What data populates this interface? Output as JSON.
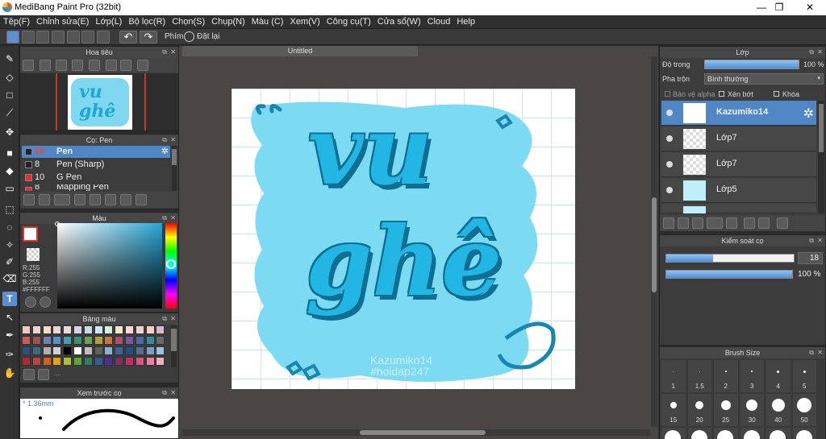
{
  "window": {
    "title": "MediBang Paint Pro (32bit)",
    "min": "—",
    "max": "❐",
    "close": "✕"
  },
  "menu": [
    "Tệp(F)",
    "Chỉnh sửa(E)",
    "Lớp(L)",
    "Bộ lọc(R)",
    "Chọn(S)",
    "Chụp(N)",
    "Màu (C)",
    "Xem(V)",
    "Công cụ(T)",
    "Cửa sổ(W)",
    "Cloud",
    "Help"
  ],
  "toolbar": {
    "shortcut_label": "Phím",
    "reset_label": "Đặt lại"
  },
  "navigator": {
    "title": "Hoa tiêu"
  },
  "brush_panel": {
    "title": "Cọ: Pen",
    "items": [
      {
        "size": "18",
        "name": "Pen",
        "color": "#222222"
      },
      {
        "size": "8",
        "name": "Pen (Sharp)",
        "color": "#222222"
      },
      {
        "size": "10",
        "name": "G Pen",
        "color": "#e03030"
      },
      {
        "size": "8",
        "name": "Mapping Pen",
        "color": "#e03030"
      }
    ]
  },
  "color_panel": {
    "title": "Màu",
    "r": "R:255",
    "g": "G:255",
    "b": "B:255",
    "hex": "#FFFFFF"
  },
  "palette_panel": {
    "title": "Bảng màu",
    "more": "...."
  },
  "preview_panel": {
    "title": "Xem trước cọ",
    "size": "* 1.36mm"
  },
  "document": {
    "tab": "Untitled"
  },
  "artwork": {
    "line1": "vu",
    "line2": "ghê",
    "watermark1": "Kazumiko14",
    "watermark2": "#hoidap247"
  },
  "layers_panel": {
    "title": "Lớp",
    "opacity_label": "Độ trong",
    "opacity_value": "100 %",
    "blend_label": "Pha trộn",
    "blend_value": "Bình thường",
    "protect_alpha": "Bảo vệ alpha",
    "clipping": "Xén bớt",
    "lock": "Khóa",
    "layers": [
      {
        "name": "Kazumiko14",
        "selected": true
      },
      {
        "name": "Lớp7",
        "selected": false
      },
      {
        "name": "Lớp7",
        "selected": false
      },
      {
        "name": "Lớp5",
        "selected": false
      }
    ]
  },
  "brush_control": {
    "title": "Kiểm soát cọ",
    "size_value": "18",
    "opacity_value": "100 %"
  },
  "brush_size_panel": {
    "title": "Brush Size",
    "labels_row1": [
      "1",
      "1.5",
      "2",
      "3",
      "4",
      "5"
    ],
    "labels_row2": [
      "15",
      "20",
      "25",
      "30",
      "40",
      "50"
    ]
  }
}
